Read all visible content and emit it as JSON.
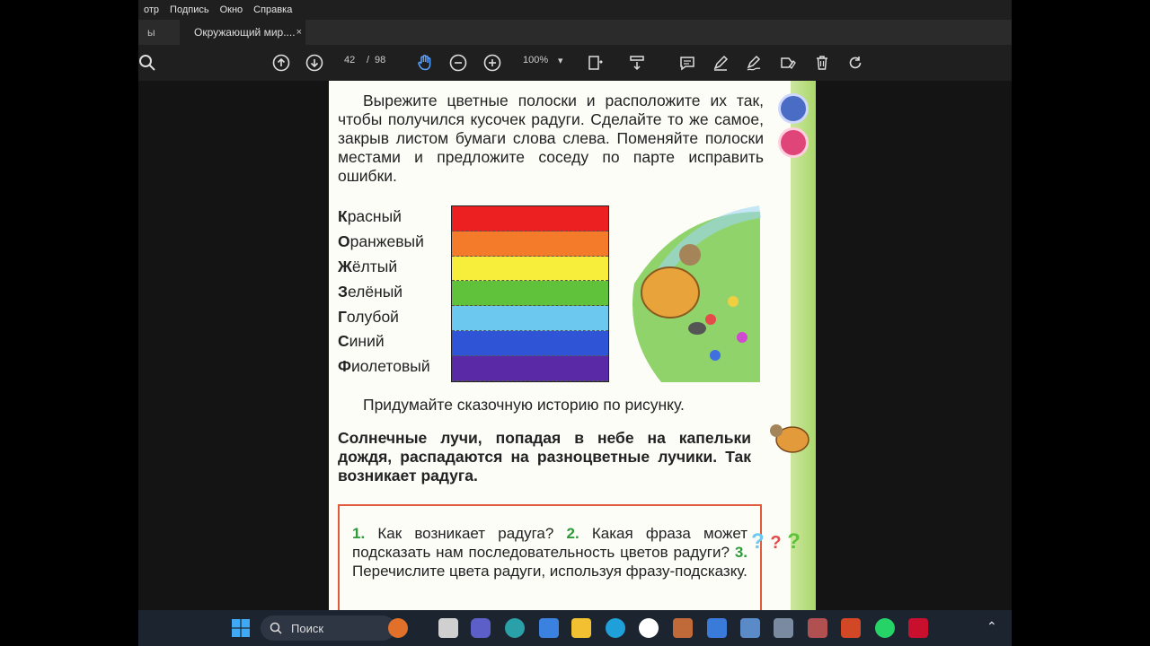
{
  "menu": [
    "отр",
    "Подпись",
    "Окно",
    "Справка"
  ],
  "tabs": {
    "inactive_label": "ы",
    "active_label": "Окружающий мир....",
    "close_glyph": "×"
  },
  "toolbar": {
    "page_current": "42",
    "page_sep": "/",
    "page_total": "98",
    "zoom": "100%",
    "zoom_caret": "▾"
  },
  "page": {
    "para1": "Вырежите цветные полоски и расположите их так, чтобы получился кусочек радуги. Сделайте то же самое, закрыв листом бумаги слова слева. Поменяйте полоски местами и предложите соседу по парте исправить ошибки.",
    "colors": [
      {
        "first": "К",
        "rest": "расный",
        "hex": "#ec2020"
      },
      {
        "first": "О",
        "rest": "ранжевый",
        "hex": "#f47b2a"
      },
      {
        "first": "Ж",
        "rest": "ёлтый",
        "hex": "#f6ee3a"
      },
      {
        "first": "З",
        "rest": "елёный",
        "hex": "#5fc23a"
      },
      {
        "first": "Г",
        "rest": "олубой",
        "hex": "#6cc8ef"
      },
      {
        "first": "С",
        "rest": "иний",
        "hex": "#2f54d6"
      },
      {
        "first": "Ф",
        "rest": "иолетовый",
        "hex": "#5a2aa6"
      }
    ],
    "para2": "Придумайте сказочную историю по рисунку.",
    "para3": "Солнечные лучи, попадая в небе на капельки дождя, распадаются на разноцветные лучики. Так возникает радуга.",
    "questions": {
      "n1": "1.",
      "q1": "Как возникает радуга?",
      "n2": "2.",
      "q2": "Какая фраза может подсказать нам последовательность цветов радуги?",
      "n3": "3.",
      "q3": "Перечислите цвета радуги, используя фразу-подсказку."
    },
    "qmark": "?"
  },
  "taskbar": {
    "search_label": "Поиск",
    "chevron": "⌃"
  },
  "colors": {
    "menubar_bg": "#1f1f1f",
    "page_bg": "#fdfdf8",
    "qbox_border": "#e25a3c",
    "taskbar_bg": "#1c2430"
  }
}
